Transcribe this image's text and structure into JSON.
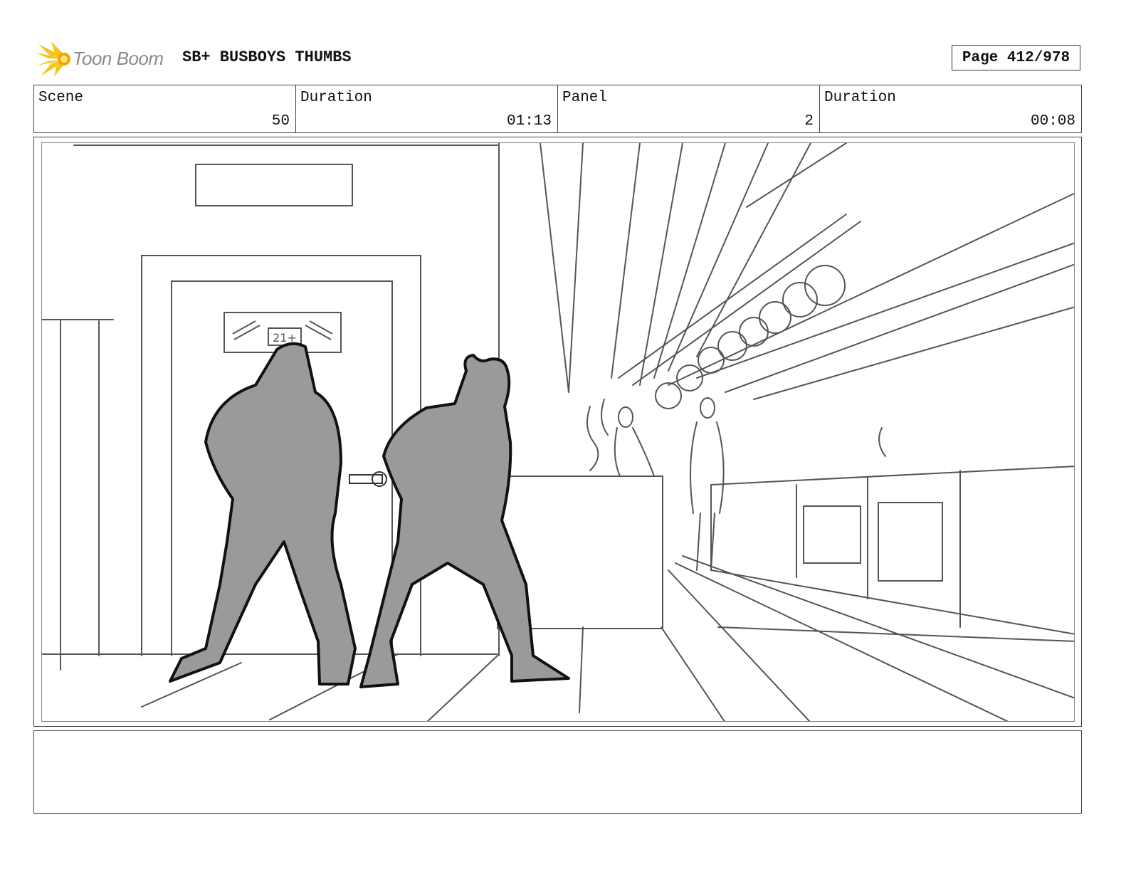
{
  "header": {
    "logo_text": "Toon Boom",
    "project_title": "SB+ BUSBOYS THUMBS",
    "page_label": "Page 412/978"
  },
  "info": {
    "scene_label": "Scene",
    "scene_value": "50",
    "scene_duration_label": "Duration",
    "scene_duration_value": "01:13",
    "panel_label": "Panel",
    "panel_value": "2",
    "panel_duration_label": "Duration",
    "panel_duration_value": "00:08"
  },
  "panel": {
    "sign_text": "21+"
  },
  "notes": {
    "text": ""
  },
  "colors": {
    "logo_yellow": "#f5c518",
    "logo_orange": "#f0a400",
    "figure_fill": "#9a9a9a",
    "sketch_line": "#555555"
  }
}
